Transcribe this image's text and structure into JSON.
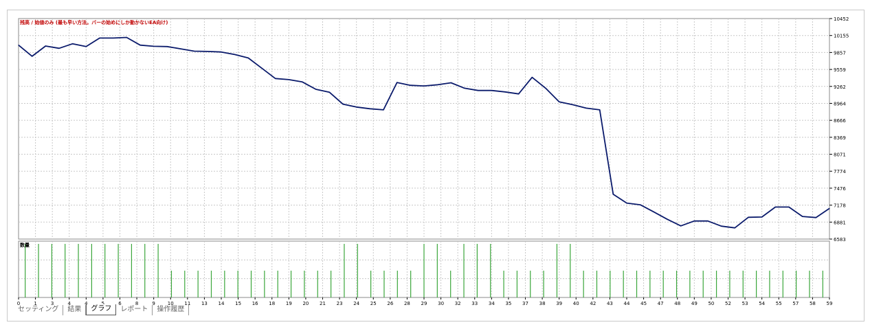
{
  "window": {
    "main_title": "残高 / 始値のみ (最も早い方法。バーの始めにしか動かないEA向け)",
    "volume_title": "数量"
  },
  "tabs": [
    {
      "label": "セッティング",
      "active": false
    },
    {
      "label": "結果",
      "active": false
    },
    {
      "label": "グラフ",
      "active": true
    },
    {
      "label": "レポート",
      "active": false
    },
    {
      "label": "操作履歴",
      "active": false
    }
  ],
  "colors": {
    "balance_line": "#0a1a6b",
    "volume_bar": "#3aa63a",
    "grid": "#c8c8c8",
    "title": "#c00000",
    "axis_text": "#000000"
  },
  "chart_data": {
    "type": "line",
    "title": "残高 / 始値のみ (最も早い方法。バーの始めにしか動かないEA向け)",
    "y_ticks": [
      "10452",
      "10155",
      "9857",
      "9559",
      "9262",
      "8964",
      "8666",
      "8369",
      "8071",
      "7774",
      "7476",
      "7178",
      "6881",
      "6583"
    ],
    "ylim": [
      6583,
      10452
    ],
    "x_labels": [
      "0",
      "1",
      "3",
      "4",
      "4",
      "5",
      "6",
      "8",
      "9",
      "10",
      "11",
      "13",
      "14",
      "15",
      "16",
      "18",
      "19",
      "20",
      "21",
      "23",
      "24",
      "25",
      "26",
      "28",
      "29",
      "30",
      "32",
      "33",
      "34",
      "35",
      "37",
      "38",
      "39",
      "40",
      "42",
      "43",
      "44",
      "45",
      "47",
      "48",
      "49",
      "50",
      "52",
      "53",
      "54",
      "55",
      "57",
      "58",
      "59"
    ],
    "grid": true,
    "series": [
      {
        "values": [
          9985,
          9790,
          9970,
          9930,
          10010,
          9960,
          10110,
          10110,
          10120,
          9985,
          9965,
          9960,
          9920,
          9880,
          9875,
          9865,
          9820,
          9760,
          9580,
          9400,
          9380,
          9340,
          9210,
          9160,
          8950,
          8900,
          8870,
          8850,
          9330,
          9280,
          9270,
          9290,
          9325,
          9230,
          9190,
          9190,
          9165,
          9130,
          9420,
          9230,
          8990,
          8940,
          8880,
          8850,
          7370,
          7215,
          7185,
          7060,
          6930,
          6815,
          6900,
          6900,
          6810,
          6780,
          6965,
          6970,
          7145,
          7145,
          6980,
          6960,
          7120
        ]
      }
    ],
    "volume": {
      "title": "数量",
      "values": [
        2,
        2,
        2,
        2,
        2,
        2,
        2,
        2,
        2,
        2,
        2,
        1,
        1,
        1,
        1,
        1,
        1,
        1,
        1,
        1,
        1,
        1,
        1,
        1,
        2,
        2,
        1,
        1,
        1,
        1,
        2,
        2,
        1,
        2,
        2,
        2,
        1,
        1,
        1,
        1,
        2,
        2,
        1,
        1,
        1,
        1,
        1,
        1,
        1,
        1,
        1,
        1,
        1,
        1,
        1,
        1,
        1,
        1,
        1,
        1,
        1
      ]
    }
  }
}
